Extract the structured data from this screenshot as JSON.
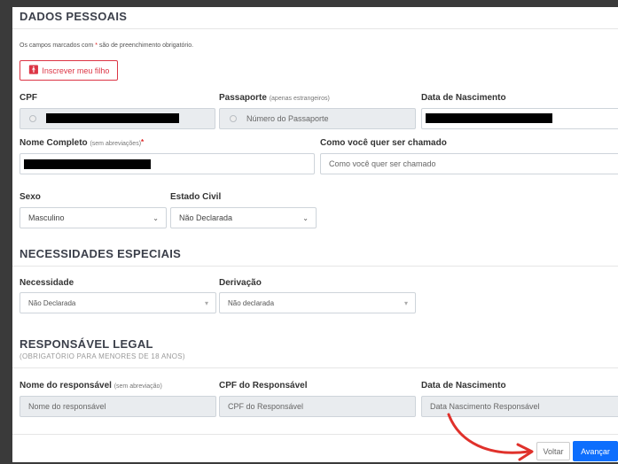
{
  "dados_pessoais": {
    "title": "DADOS PESSOAIS",
    "required_note_pre": "Os campos marcados com",
    "required_star": "*",
    "required_note_post": "são de preenchimento obrigatório.",
    "enroll_button": "Inscrever meu filho",
    "cpf_label": "CPF",
    "passport_label": "Passaporte",
    "passport_hint": "(apenas estrangeiros)",
    "passport_placeholder": "Número do Passaporte",
    "birthdate_label": "Data de Nascimento",
    "fullname_label": "Nome Completo",
    "fullname_hint": "(sem abreviações)",
    "nickname_label": "Como você quer ser chamado",
    "nickname_placeholder": "Como você quer ser chamado",
    "sex_label": "Sexo",
    "sex_value": "Masculino",
    "civil_label": "Estado Civil",
    "civil_value": "Não Declarada"
  },
  "necessidades": {
    "title": "NECESSIDADES ESPECIAIS",
    "need_label": "Necessidade",
    "need_value": "Não Declarada",
    "deriv_label": "Derivação",
    "deriv_value": "Não declarada"
  },
  "responsavel": {
    "title": "RESPONSÁVEL LEGAL",
    "subtitle": "(OBRIGATÓRIO PARA MENORES DE 18 ANOS)",
    "name_label": "Nome do responsável",
    "name_hint": "(sem abreviação)",
    "name_placeholder": "Nome do responsável",
    "cpf_label": "CPF do Responsável",
    "cpf_placeholder": "CPF do Responsável",
    "birth_label": "Data de Nascimento",
    "birth_placeholder": "Data Nascimento Responsável"
  },
  "footer": {
    "back": "Voltar",
    "next": "Avançar"
  },
  "colors": {
    "primary": "#0d6efd",
    "danger": "#dc3545",
    "arrow": "#e0312b"
  }
}
